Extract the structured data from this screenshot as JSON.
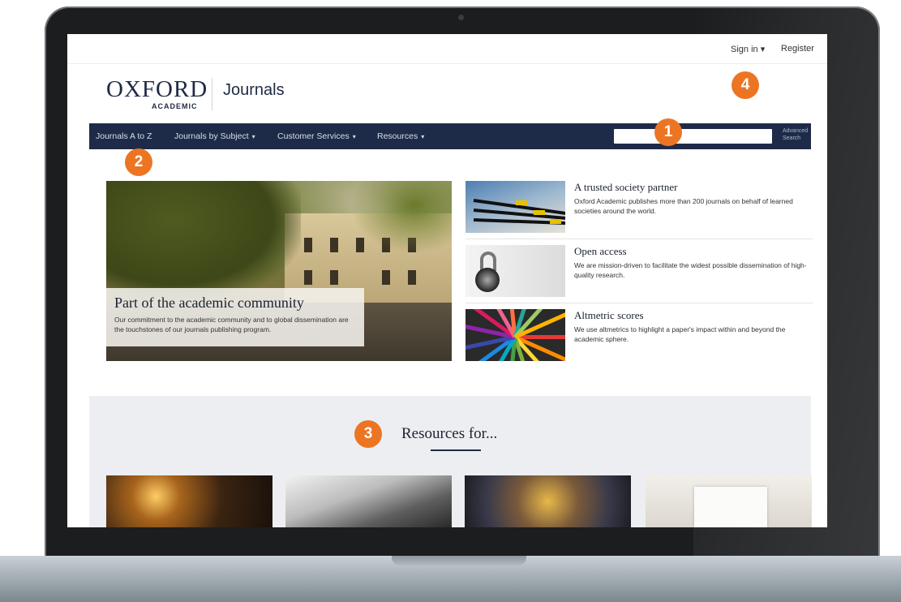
{
  "header": {
    "sign_in_label": "Sign in ▾",
    "register_label": "Register",
    "logo_oxford": "OXFORD",
    "logo_academic": "ACADEMIC",
    "site_name": "Journals"
  },
  "nav": {
    "items": [
      {
        "label": "Journals A to Z",
        "caret": ""
      },
      {
        "label": "Journals by Subject",
        "caret": "▾"
      },
      {
        "label": "Customer Services",
        "caret": "▾"
      },
      {
        "label": "Resources",
        "caret": "▾"
      }
    ],
    "search_value": "",
    "advanced_search_line1": "Advanced",
    "advanced_search_line2": "Search"
  },
  "callouts": [
    "1",
    "2",
    "3",
    "4"
  ],
  "hero": {
    "title": "Part of the academic community",
    "text": "Our commitment to the academic community and to global dissemination are the touchstones of our journals publishing program."
  },
  "features": [
    {
      "title": "A trusted society partner",
      "text": "Oxford Academic publishes more than 200 journals on behalf of learned societies around the world."
    },
    {
      "title": "Open access",
      "text": "We are mission-driven to facilitate the widest possible dissemination of high-quality research."
    },
    {
      "title": "Altmetric scores",
      "text": "We use altmetrics to highlight a paper's impact within and beyond the academic sphere."
    }
  ],
  "resources": {
    "title": "Resources for..."
  },
  "colors": {
    "navbar": "#1e2b48",
    "callout": "#ec7524",
    "resources_bg": "#eceef1"
  }
}
